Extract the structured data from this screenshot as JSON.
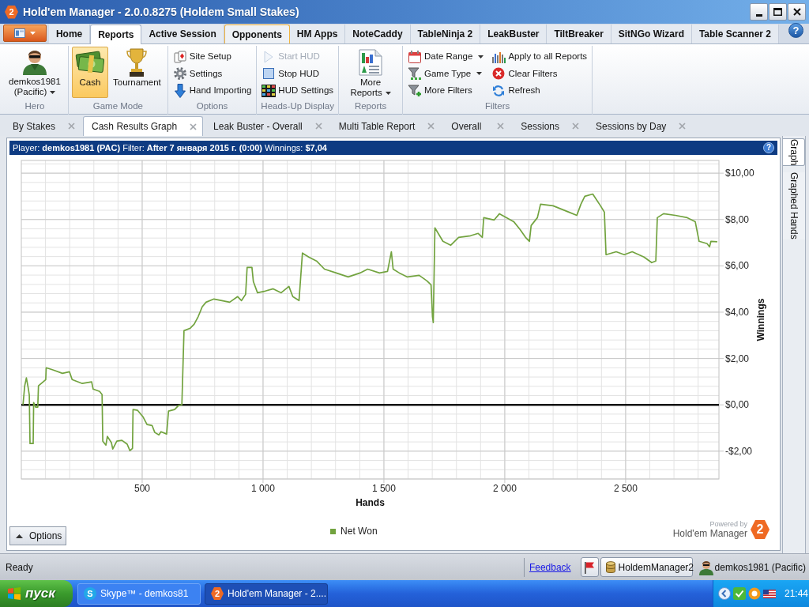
{
  "window": {
    "logo": "2",
    "title": "Hold'em Manager - 2.0.0.8275 (Holdem Small Stakes)"
  },
  "ribbon_tabs": [
    {
      "label": "Home",
      "selected": false,
      "highlighted": false
    },
    {
      "label": "Reports",
      "selected": true,
      "highlighted": false
    },
    {
      "label": "Active Session",
      "selected": false,
      "highlighted": false
    },
    {
      "label": "Opponents",
      "selected": false,
      "highlighted": true
    },
    {
      "label": "HM Apps",
      "selected": false,
      "highlighted": false
    },
    {
      "label": "NoteCaddy",
      "selected": false,
      "highlighted": false
    },
    {
      "label": "TableNinja 2",
      "selected": false,
      "highlighted": false
    },
    {
      "label": "LeakBuster",
      "selected": false,
      "highlighted": false
    },
    {
      "label": "TiltBreaker",
      "selected": false,
      "highlighted": false
    },
    {
      "label": "SitNGo Wizard",
      "selected": false,
      "highlighted": false
    },
    {
      "label": "Table Scanner 2",
      "selected": false,
      "highlighted": false
    }
  ],
  "help": "?",
  "ribbon_groups": [
    {
      "label": "Hero",
      "items": [
        {
          "kind": "profile",
          "label": "demkos1981 (Pacific)",
          "dropdown": true
        }
      ]
    },
    {
      "label": "Game Mode",
      "items": [
        {
          "kind": "large",
          "label": "Cash",
          "selected": true,
          "dropdown": false
        },
        {
          "kind": "large",
          "label": "Tournament",
          "selected": false,
          "dropdown": false
        }
      ]
    },
    {
      "label": "Options",
      "items": [
        {
          "kind": "small",
          "label": "Site Setup",
          "dropdown": false
        },
        {
          "kind": "small",
          "label": "Settings",
          "dropdown": false
        },
        {
          "kind": "small",
          "label": "Hand Importing",
          "dropdown": false
        }
      ]
    },
    {
      "label": "Heads-Up Display",
      "items": [
        {
          "kind": "small",
          "label": "Start HUD",
          "disabled": true,
          "dropdown": false
        },
        {
          "kind": "small",
          "label": "Stop HUD",
          "disabled": false,
          "dropdown": false
        },
        {
          "kind": "small",
          "label": "HUD Settings",
          "disabled": false,
          "dropdown": false
        }
      ]
    },
    {
      "label": "Reports",
      "items": [
        {
          "kind": "large",
          "label": "More Reports",
          "dropdown": true
        }
      ]
    },
    {
      "label": "Filters",
      "items": [
        {
          "kind": "small",
          "label": "Date Range",
          "dropdown": true
        },
        {
          "kind": "small",
          "label": "Game Type",
          "dropdown": true
        },
        {
          "kind": "small",
          "label": "More Filters",
          "dropdown": false
        },
        {
          "kind": "small",
          "label": "Apply to all Reports",
          "dropdown": false
        },
        {
          "kind": "small",
          "label": "Clear Filters",
          "dropdown": false
        },
        {
          "kind": "small",
          "label": "Refresh",
          "dropdown": false
        }
      ]
    }
  ],
  "report_tabs": [
    {
      "label": "By Stakes",
      "selected": false
    },
    {
      "label": "Cash Results Graph",
      "selected": true
    },
    {
      "label": "Leak Buster - Overall",
      "selected": false
    },
    {
      "label": "Multi Table Report",
      "selected": false
    },
    {
      "label": "Overall",
      "selected": false
    },
    {
      "label": "Sessions",
      "selected": false
    },
    {
      "label": "Sessions by Day",
      "selected": false
    }
  ],
  "report": {
    "header": "Player: **demkos1981 (PAC)** Filter: **After 7 января 2015 г. (0:00)** Winnings: **$7,04**",
    "help": "?",
    "side_tabs": [
      {
        "label": "Graph",
        "selected": true
      },
      {
        "label": "Graphed Hands",
        "selected": false
      }
    ],
    "chart_data": {
      "type": "line",
      "xlabel": "Hands",
      "ylabel": "Winnings",
      "grid": true,
      "x": [
        7,
        14,
        21,
        28,
        33,
        36,
        49,
        51,
        59,
        68,
        71,
        101,
        103,
        133,
        170,
        199,
        210,
        252,
        291,
        297,
        324,
        334,
        337,
        350,
        356,
        373,
        378,
        395,
        416,
        438,
        449,
        460,
        462,
        481,
        503,
        520,
        541,
        552,
        569,
        578,
        601,
        609,
        634,
        650,
        664,
        673,
        699,
        715,
        732,
        748,
        764,
        797,
        830,
        862,
        895,
        911,
        928,
        934,
        954,
        960,
        977,
        1009,
        1042,
        1075,
        1107,
        1123,
        1149,
        1163,
        1189,
        1221,
        1254,
        1303,
        1352,
        1401,
        1433,
        1482,
        1515,
        1531,
        1538,
        1564,
        1597,
        1646,
        1678,
        1695,
        1701,
        1704,
        1711,
        1744,
        1776,
        1809,
        1858,
        1890,
        1907,
        1913,
        1956,
        1978,
        2037,
        2063,
        2086,
        2102,
        2109,
        2135,
        2148,
        2200,
        2265,
        2298,
        2315,
        2331,
        2364,
        2396,
        2412,
        2419,
        2461,
        2494,
        2527,
        2576,
        2608,
        2625,
        2631,
        2657,
        2706,
        2755,
        2788,
        2804,
        2837,
        2847,
        2853,
        2879
      ],
      "series": [
        {
          "name": "Net Won",
          "color": "#72a33f",
          "values": [
            0.0,
            0.82,
            1.16,
            0.75,
            0.41,
            -1.67,
            -1.67,
            0.1,
            -0.1,
            -0.1,
            0.82,
            1.09,
            1.6,
            1.5,
            1.36,
            1.43,
            1.09,
            0.92,
            0.99,
            0.68,
            0.58,
            0.44,
            -1.57,
            -1.74,
            -1.36,
            -1.64,
            -1.91,
            -1.57,
            -1.53,
            -1.7,
            -1.98,
            -1.88,
            -0.2,
            -0.24,
            -0.51,
            -0.85,
            -0.89,
            -1.19,
            -1.3,
            -1.16,
            -1.26,
            -0.27,
            -0.2,
            -0.03,
            0.0,
            3.2,
            3.31,
            3.48,
            3.82,
            4.23,
            4.43,
            4.57,
            4.5,
            4.43,
            4.67,
            4.5,
            4.77,
            5.93,
            5.93,
            5.32,
            4.84,
            4.91,
            5.01,
            4.84,
            5.11,
            4.67,
            4.5,
            6.55,
            6.38,
            6.21,
            5.86,
            5.69,
            5.52,
            5.69,
            5.86,
            5.69,
            5.76,
            6.61,
            5.86,
            5.69,
            5.52,
            5.59,
            5.35,
            5.18,
            3.82,
            3.55,
            7.64,
            7.06,
            6.89,
            7.23,
            7.3,
            7.4,
            7.23,
            8.08,
            7.98,
            8.25,
            7.91,
            7.57,
            7.23,
            7.06,
            7.74,
            8.08,
            8.66,
            8.59,
            8.32,
            8.18,
            8.66,
            9.0,
            9.1,
            8.59,
            8.32,
            6.48,
            6.61,
            6.48,
            6.61,
            6.38,
            6.14,
            6.21,
            8.08,
            8.25,
            8.18,
            8.08,
            7.91,
            7.06,
            6.96,
            6.82,
            7.06,
            7.04
          ]
        }
      ],
      "xlim": [
        0,
        2886
      ],
      "ylim": [
        -3.2,
        10.55
      ],
      "xticks": [
        {
          "value": 500,
          "label": "500"
        },
        {
          "value": 1000,
          "label": "1 000"
        },
        {
          "value": 1500,
          "label": "1 500"
        },
        {
          "value": 2000,
          "label": "2 000"
        },
        {
          "value": 2500,
          "label": "2 500"
        }
      ],
      "yticks": [
        {
          "value": -2,
          "label": "-$2,00"
        },
        {
          "value": 0,
          "label": "$0,00"
        },
        {
          "value": 2,
          "label": "$2,00"
        },
        {
          "value": 4,
          "label": "$4,00"
        },
        {
          "value": 6,
          "label": "$6,00"
        },
        {
          "value": 8,
          "label": "$8,00"
        },
        {
          "value": 10,
          "label": "$10,00"
        }
      ]
    },
    "options_button": "Options",
    "branding": {
      "powered_by": "Powered by",
      "product": "Hold'em Manager",
      "logo": "2"
    }
  },
  "status_bar": {
    "status": "Ready",
    "feedback_link": "Feedback",
    "database_button": "HoldemManager2",
    "user": "demkos1981 (Pacific)"
  },
  "taskbar": {
    "start_button": "пуск",
    "tasks": [
      {
        "icon_text": "S",
        "label": "Skype™ - demkos81",
        "selected": false
      },
      {
        "icon_text": "2",
        "label": "Hold'em Manager - 2....",
        "selected": true
      }
    ],
    "clock": "21:44"
  }
}
